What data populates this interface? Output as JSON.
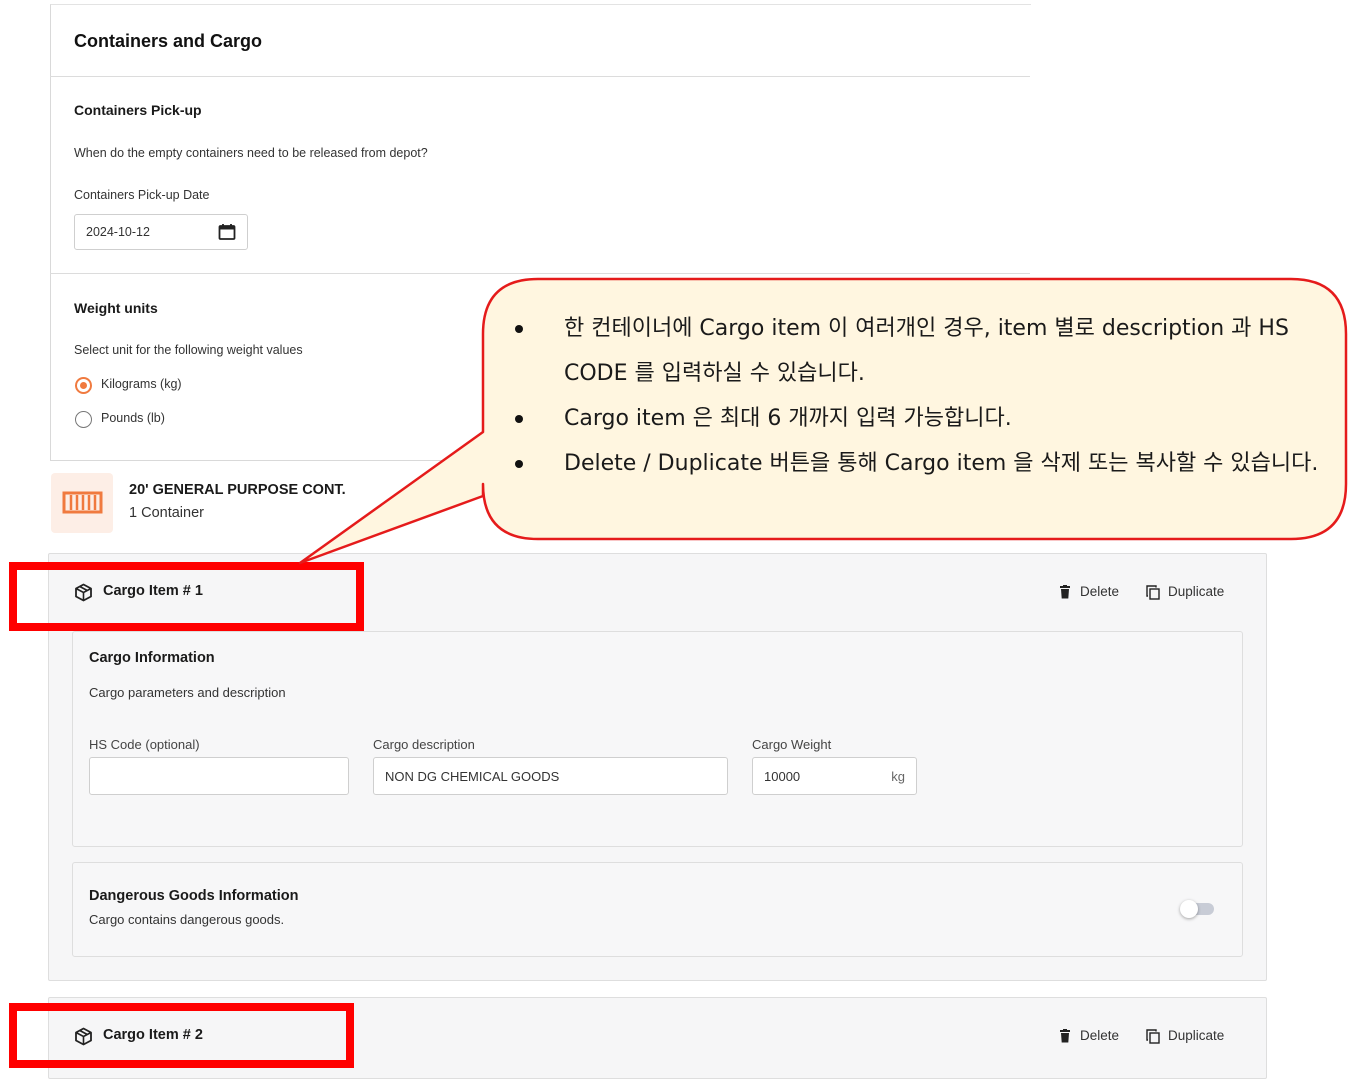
{
  "section": {
    "title": "Containers and Cargo",
    "pickup": {
      "heading": "Containers Pick-up",
      "question": "When do the empty containers need to be released from depot?",
      "date_label": "Containers Pick-up Date",
      "date_value": "2024-10-12"
    },
    "weight": {
      "heading": "Weight units",
      "desc": "Select unit for the following weight values",
      "options": [
        {
          "label": "Kilograms (kg)",
          "selected": true
        },
        {
          "label": "Pounds (lb)",
          "selected": false
        }
      ]
    }
  },
  "container": {
    "type": "20' GENERAL PURPOSE CONT.",
    "count": "1 Container"
  },
  "cargo_items": [
    {
      "title": "Cargo Item # 1",
      "delete_label": "Delete",
      "duplicate_label": "Duplicate",
      "info_title": "Cargo Information",
      "info_desc": "Cargo parameters and description",
      "hs_label": "HS Code (optional)",
      "hs_value": "",
      "desc_label": "Cargo description",
      "desc_value": "NON DG CHEMICAL GOODS",
      "weight_label": "Cargo Weight",
      "weight_value": "10000",
      "weight_unit": "kg",
      "dg_title": "Dangerous Goods Information",
      "dg_desc": "Cargo contains dangerous goods."
    },
    {
      "title": "Cargo Item # 2",
      "delete_label": "Delete",
      "duplicate_label": "Duplicate"
    }
  ],
  "callout": {
    "bullets": [
      "한 컨테이너에 Cargo item 이 여러개인 경우, item 별로 description 과 HS CODE 를  입력하실 수 있습니다.",
      "Cargo item 은 최대 6 개까지 입력 가능합니다.",
      "Delete / Duplicate 버튼을 통해 Cargo item 을 삭제 또는 복사할 수 있습니다."
    ]
  },
  "colors": {
    "accent": "#f07a3f",
    "highlight": "#ff0000",
    "callout_fill": "#fff6e0"
  }
}
